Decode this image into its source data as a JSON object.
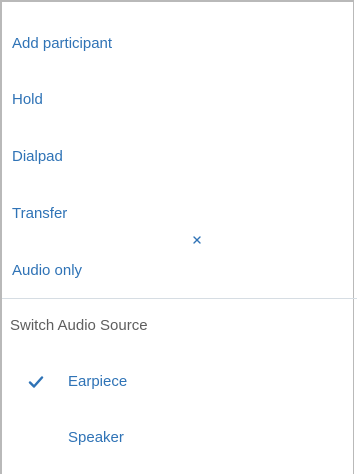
{
  "menu": {
    "items": [
      {
        "label": "Add participant"
      },
      {
        "label": "Hold"
      },
      {
        "label": "Dialpad"
      },
      {
        "label": "Transfer"
      },
      {
        "label": "Audio only"
      }
    ]
  },
  "audio_source": {
    "title": "Switch Audio Source",
    "options": [
      {
        "label": "Earpiece",
        "selected": true
      },
      {
        "label": "Speaker",
        "selected": false
      }
    ]
  },
  "icons": {
    "check": "check-icon",
    "close": "close-icon"
  },
  "colors": {
    "link": "#2f73b6",
    "section_title": "#5e5e5e",
    "divider": "#d6dde3",
    "border": "#b9b9b9"
  }
}
